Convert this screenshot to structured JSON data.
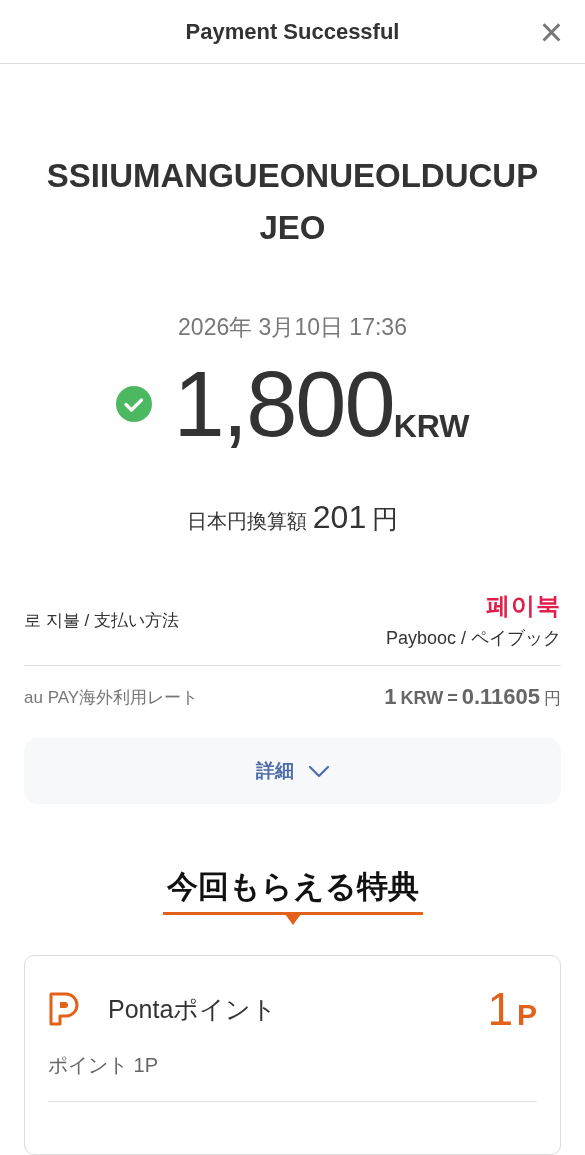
{
  "header": {
    "title": "Payment Successful",
    "close": "×"
  },
  "merchant": "SSIIUMANGUEONUEOLDUCUPJEO",
  "datetime": "2026年 3月10日 17:36",
  "amount": {
    "success": true,
    "value": "1,800",
    "currency": "KRW"
  },
  "converted": {
    "label": "日本円換算額",
    "value": "201",
    "unit": "円"
  },
  "payment_method": {
    "label": "로 지불 / 支払い方法",
    "brand": "페이북",
    "name": "Paybooc / ペイブック"
  },
  "rate": {
    "label": "au PAY海外利用レート",
    "base": "1",
    "base_currency": "KRW",
    "equals": "=",
    "value": "0.11605",
    "unit": "円"
  },
  "details_button": {
    "label": "詳細",
    "expanded": false
  },
  "benefits": {
    "title": "今回もらえる特典",
    "cards": [
      {
        "name": "Pontaポイント",
        "points": "1",
        "points_unit": "P",
        "detail": "ポイント 1P"
      }
    ]
  }
}
